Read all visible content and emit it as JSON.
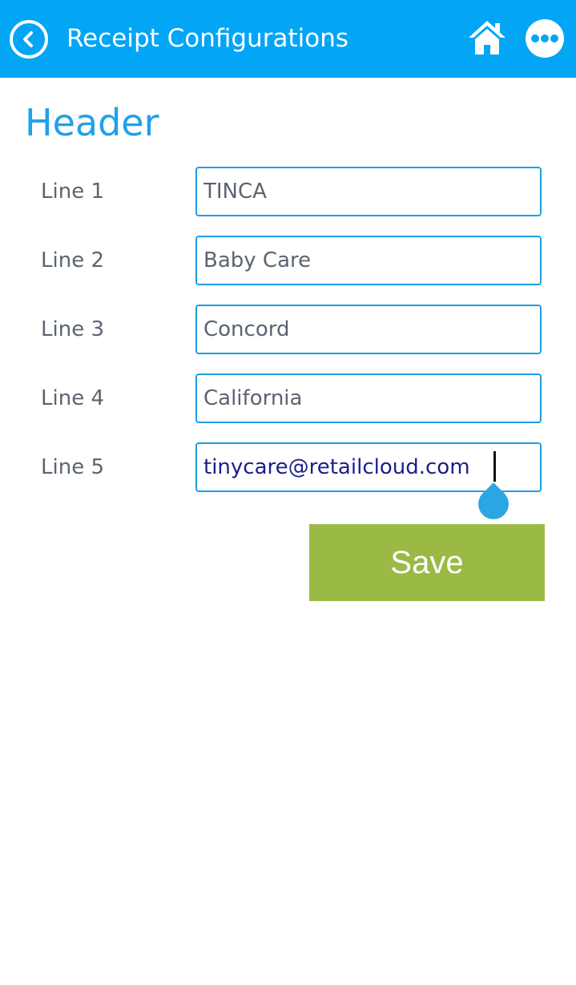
{
  "header": {
    "title": "Receipt Configurations",
    "back_icon": "chevron-left-circle-icon",
    "home_icon": "home-icon",
    "more_icon": "more-dots-icon",
    "bar_color": "#03a5f5"
  },
  "section": {
    "title": "Header",
    "title_color": "#1fa1e8"
  },
  "lines": [
    {
      "label": "Line 1",
      "value": "TINCA"
    },
    {
      "label": "Line 2",
      "value": "Baby Care"
    },
    {
      "label": "Line 3",
      "value": "Concord"
    },
    {
      "label": "Line 4",
      "value": "California"
    },
    {
      "label": "Line 5",
      "value": "tinycare@retailcloud.com",
      "focused": true
    }
  ],
  "save_button": {
    "label": "Save",
    "color": "#9aba45"
  }
}
